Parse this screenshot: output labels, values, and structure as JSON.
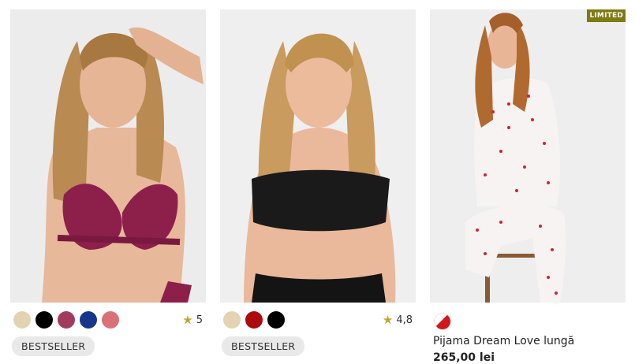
{
  "products": [
    {
      "image_alt": "",
      "swatches": [
        "#e3d3b3",
        "#000000",
        "#a23a5e",
        "#17358a",
        "#d9707a"
      ],
      "rating": "5",
      "badge": "BESTSELLER"
    },
    {
      "image_alt": "",
      "swatches": [
        "#e3d3b3",
        "#ad0a0e",
        "#000000"
      ],
      "rating": "4,8",
      "badge": "BESTSELLER"
    },
    {
      "image_alt": "",
      "flag": "LIMITED",
      "swatches": [
        "#ffffff",
        "#d3161b"
      ],
      "title": "Pijama Dream Love lungă",
      "price": "265,00 lei"
    }
  ],
  "icons": {
    "star": "star-icon"
  }
}
